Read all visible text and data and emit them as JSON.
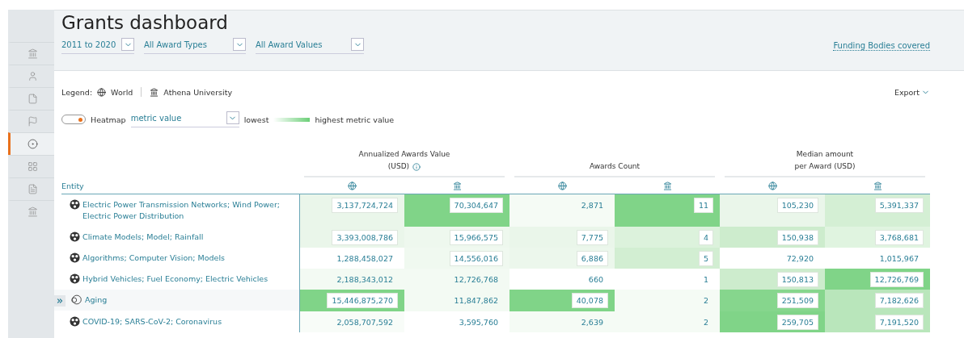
{
  "title": "Grants dashboard",
  "sidebar": {
    "items": [
      {
        "selected": false
      },
      {
        "selected": false
      },
      {
        "selected": false
      },
      {
        "selected": false
      },
      {
        "selected": true
      },
      {
        "selected": false
      },
      {
        "selected": false
      },
      {
        "selected": false
      }
    ]
  },
  "filters": [
    {
      "value": "2011 to 2020"
    },
    {
      "value": "All Award Types"
    },
    {
      "value": "All Award Values"
    }
  ],
  "funding_link": "Funding Bodies covered",
  "legend": {
    "label": "Legend:",
    "world": "World",
    "institution": "Athena University"
  },
  "export": "Export",
  "heatmap": {
    "on": true,
    "label": "Heatmap",
    "metric": "metric value",
    "low": "lowest",
    "high": "highest metric value"
  },
  "table": {
    "entity_header": "Entity",
    "groups": [
      {
        "title": "Annualized Awards Value",
        "subtitle": "(USD)",
        "info": true
      },
      {
        "title": "Awards Count"
      },
      {
        "title": "Median amount",
        "subtitle": "per Award (USD)"
      }
    ],
    "rows": [
      {
        "entity": "Electric Power Transmission Networks; Wind Power; Electric Power Distribution",
        "kind": "solid",
        "selected": false,
        "cells": [
          {
            "value": "3,137,724,724",
            "color": "#eaf6ea",
            "boxed": true
          },
          {
            "value": "70,304,647",
            "color": "#80d488",
            "boxed": true
          },
          {
            "value": "2,871",
            "color": "#f5fbf5",
            "boxed": false
          },
          {
            "value": "11",
            "color": "#80d488",
            "boxed": true
          },
          {
            "value": "105,230",
            "color": "#eaf6ea",
            "boxed": true
          },
          {
            "value": "5,391,337",
            "color": "#d4efd4",
            "boxed": true
          }
        ]
      },
      {
        "entity": "Climate Models; Model; Rainfall",
        "kind": "solid",
        "selected": false,
        "cells": [
          {
            "value": "3,393,008,786",
            "color": "#eaf6ea",
            "boxed": true
          },
          {
            "value": "15,966,575",
            "color": "#eef8ee",
            "boxed": true
          },
          {
            "value": "7,775",
            "color": "#eaf6ea",
            "boxed": true
          },
          {
            "value": "4",
            "color": "#dcf2dc",
            "boxed": true
          },
          {
            "value": "150,938",
            "color": "#cdeccd",
            "boxed": true
          },
          {
            "value": "3,768,681",
            "color": "#e0f4e0",
            "boxed": true
          }
        ]
      },
      {
        "entity": "Algorithms; Computer Vision; Models",
        "kind": "solid",
        "selected": false,
        "cells": [
          {
            "value": "1,288,458,027",
            "color": "#ffffff",
            "boxed": false
          },
          {
            "value": "14,556,016",
            "color": "#f0f9f0",
            "boxed": true
          },
          {
            "value": "6,886",
            "color": "#ecf7ec",
            "boxed": true
          },
          {
            "value": "5",
            "color": "#d2eed2",
            "boxed": true
          },
          {
            "value": "72,920",
            "color": "#ffffff",
            "boxed": false
          },
          {
            "value": "1,015,967",
            "color": "#ffffff",
            "boxed": false
          }
        ]
      },
      {
        "entity": "Hybrid Vehicles; Fuel Economy; Electric Vehicles",
        "kind": "solid",
        "selected": false,
        "cells": [
          {
            "value": "2,188,343,012",
            "color": "#f3faf3",
            "boxed": false
          },
          {
            "value": "12,726,768",
            "color": "#f3faf3",
            "boxed": false
          },
          {
            "value": "660",
            "color": "#ffffff",
            "boxed": false
          },
          {
            "value": "1",
            "color": "#ffffff",
            "boxed": false
          },
          {
            "value": "150,813",
            "color": "#cdeccd",
            "boxed": true
          },
          {
            "value": "12,726,769",
            "color": "#80d488",
            "boxed": true
          }
        ]
      },
      {
        "entity": "Aging",
        "kind": "outline",
        "selected": true,
        "cells": [
          {
            "value": "15,446,875,270",
            "color": "#80d488",
            "boxed": true
          },
          {
            "value": "11,847,862",
            "color": "#f3faf3",
            "boxed": false
          },
          {
            "value": "40,078",
            "color": "#80d488",
            "boxed": true
          },
          {
            "value": "2",
            "color": "#f5fbf5",
            "boxed": false
          },
          {
            "value": "251,509",
            "color": "#86d68d",
            "boxed": true
          },
          {
            "value": "7,182,626",
            "color": "#b9e6bb",
            "boxed": true
          }
        ]
      },
      {
        "entity": "COVID-19; SARS-CoV-2; Coronavirus",
        "kind": "solid",
        "selected": false,
        "cells": [
          {
            "value": "2,058,707,592",
            "color": "#f8fcf8",
            "boxed": false
          },
          {
            "value": "3,595,760",
            "color": "#ffffff",
            "boxed": false
          },
          {
            "value": "2,639",
            "color": "#f5fbf5",
            "boxed": false
          },
          {
            "value": "2",
            "color": "#f5fbf5",
            "boxed": false
          },
          {
            "value": "259,705",
            "color": "#80d488",
            "boxed": true
          },
          {
            "value": "7,191,520",
            "color": "#b9e6bb",
            "boxed": true
          }
        ]
      }
    ]
  }
}
